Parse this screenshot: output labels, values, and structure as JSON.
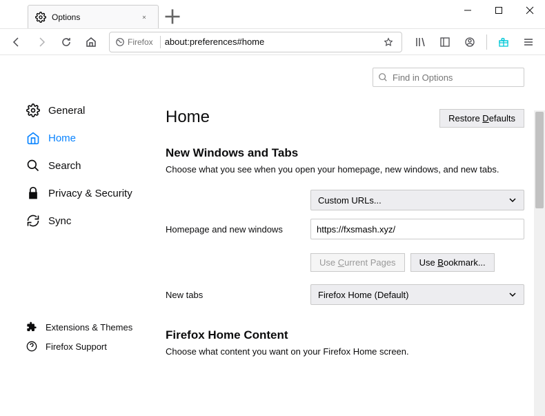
{
  "window": {
    "tab_title": "Options",
    "url_label": "Firefox",
    "url": "about:preferences#home"
  },
  "search": {
    "placeholder": "Find in Options"
  },
  "sidebar": {
    "items": [
      {
        "label": "General"
      },
      {
        "label": "Home"
      },
      {
        "label": "Search"
      },
      {
        "label": "Privacy & Security"
      },
      {
        "label": "Sync"
      }
    ],
    "footer": [
      {
        "label": "Extensions & Themes"
      },
      {
        "label": "Firefox Support"
      }
    ]
  },
  "page": {
    "heading": "Home",
    "restore_prefix": "Restore ",
    "restore_u": "D",
    "restore_suffix": "efaults",
    "section1_title": "New Windows and Tabs",
    "section1_desc": "Choose what you see when you open your homepage, new windows, and new tabs.",
    "homepage_label": "Homepage and new windows",
    "homepage_select": "Custom URLs...",
    "homepage_value": "https://fxsmash.xyz/",
    "use_current_prefix": "Use ",
    "use_current_u": "C",
    "use_current_suffix": "urrent Pages",
    "use_bookmark_prefix": "Use ",
    "use_bookmark_u": "B",
    "use_bookmark_suffix": "ookmark...",
    "newtabs_label": "New tabs",
    "newtabs_select": "Firefox Home (Default)",
    "section2_title": "Firefox Home Content",
    "section2_desc": "Choose what content you want on your Firefox Home screen."
  }
}
